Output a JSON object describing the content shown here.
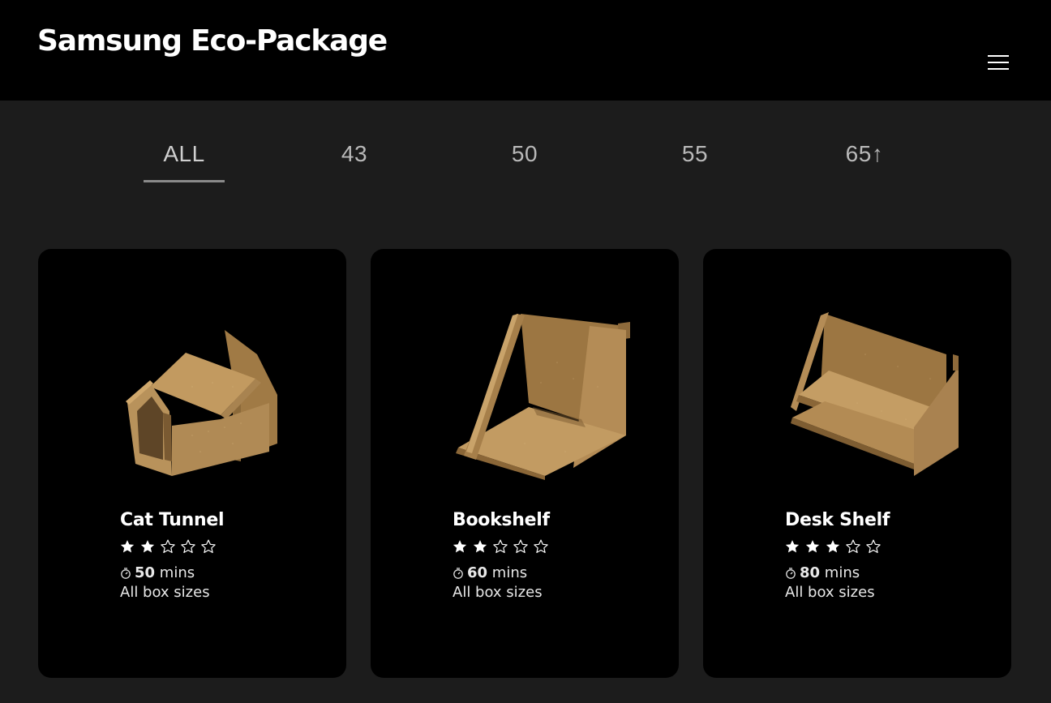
{
  "header": {
    "brand": "Samsung Eco-Package",
    "menu_icon": "hamburger-menu-icon"
  },
  "tabs": [
    {
      "label": "ALL",
      "active": true
    },
    {
      "label": "43",
      "active": false
    },
    {
      "label": "50",
      "active": false
    },
    {
      "label": "55",
      "active": false
    },
    {
      "label": "65↑",
      "active": false
    }
  ],
  "cards": [
    {
      "title": "Cat Tunnel",
      "rating": 2,
      "rating_max": 5,
      "time_value": "50",
      "time_unit": "mins",
      "sizes": "All box sizes",
      "image": "cardboard-cat-tunnel-image"
    },
    {
      "title": "Bookshelf",
      "rating": 2,
      "rating_max": 5,
      "time_value": "60",
      "time_unit": "mins",
      "sizes": "All box sizes",
      "image": "cardboard-bookshelf-image"
    },
    {
      "title": "Desk Shelf",
      "rating": 3,
      "rating_max": 5,
      "time_value": "80",
      "time_unit": "mins",
      "sizes": "All box sizes",
      "image": "cardboard-desk-shelf-image"
    }
  ],
  "colors": {
    "background": "#1c1c1c",
    "card": "#000000",
    "cardboard": "#b48a52"
  }
}
